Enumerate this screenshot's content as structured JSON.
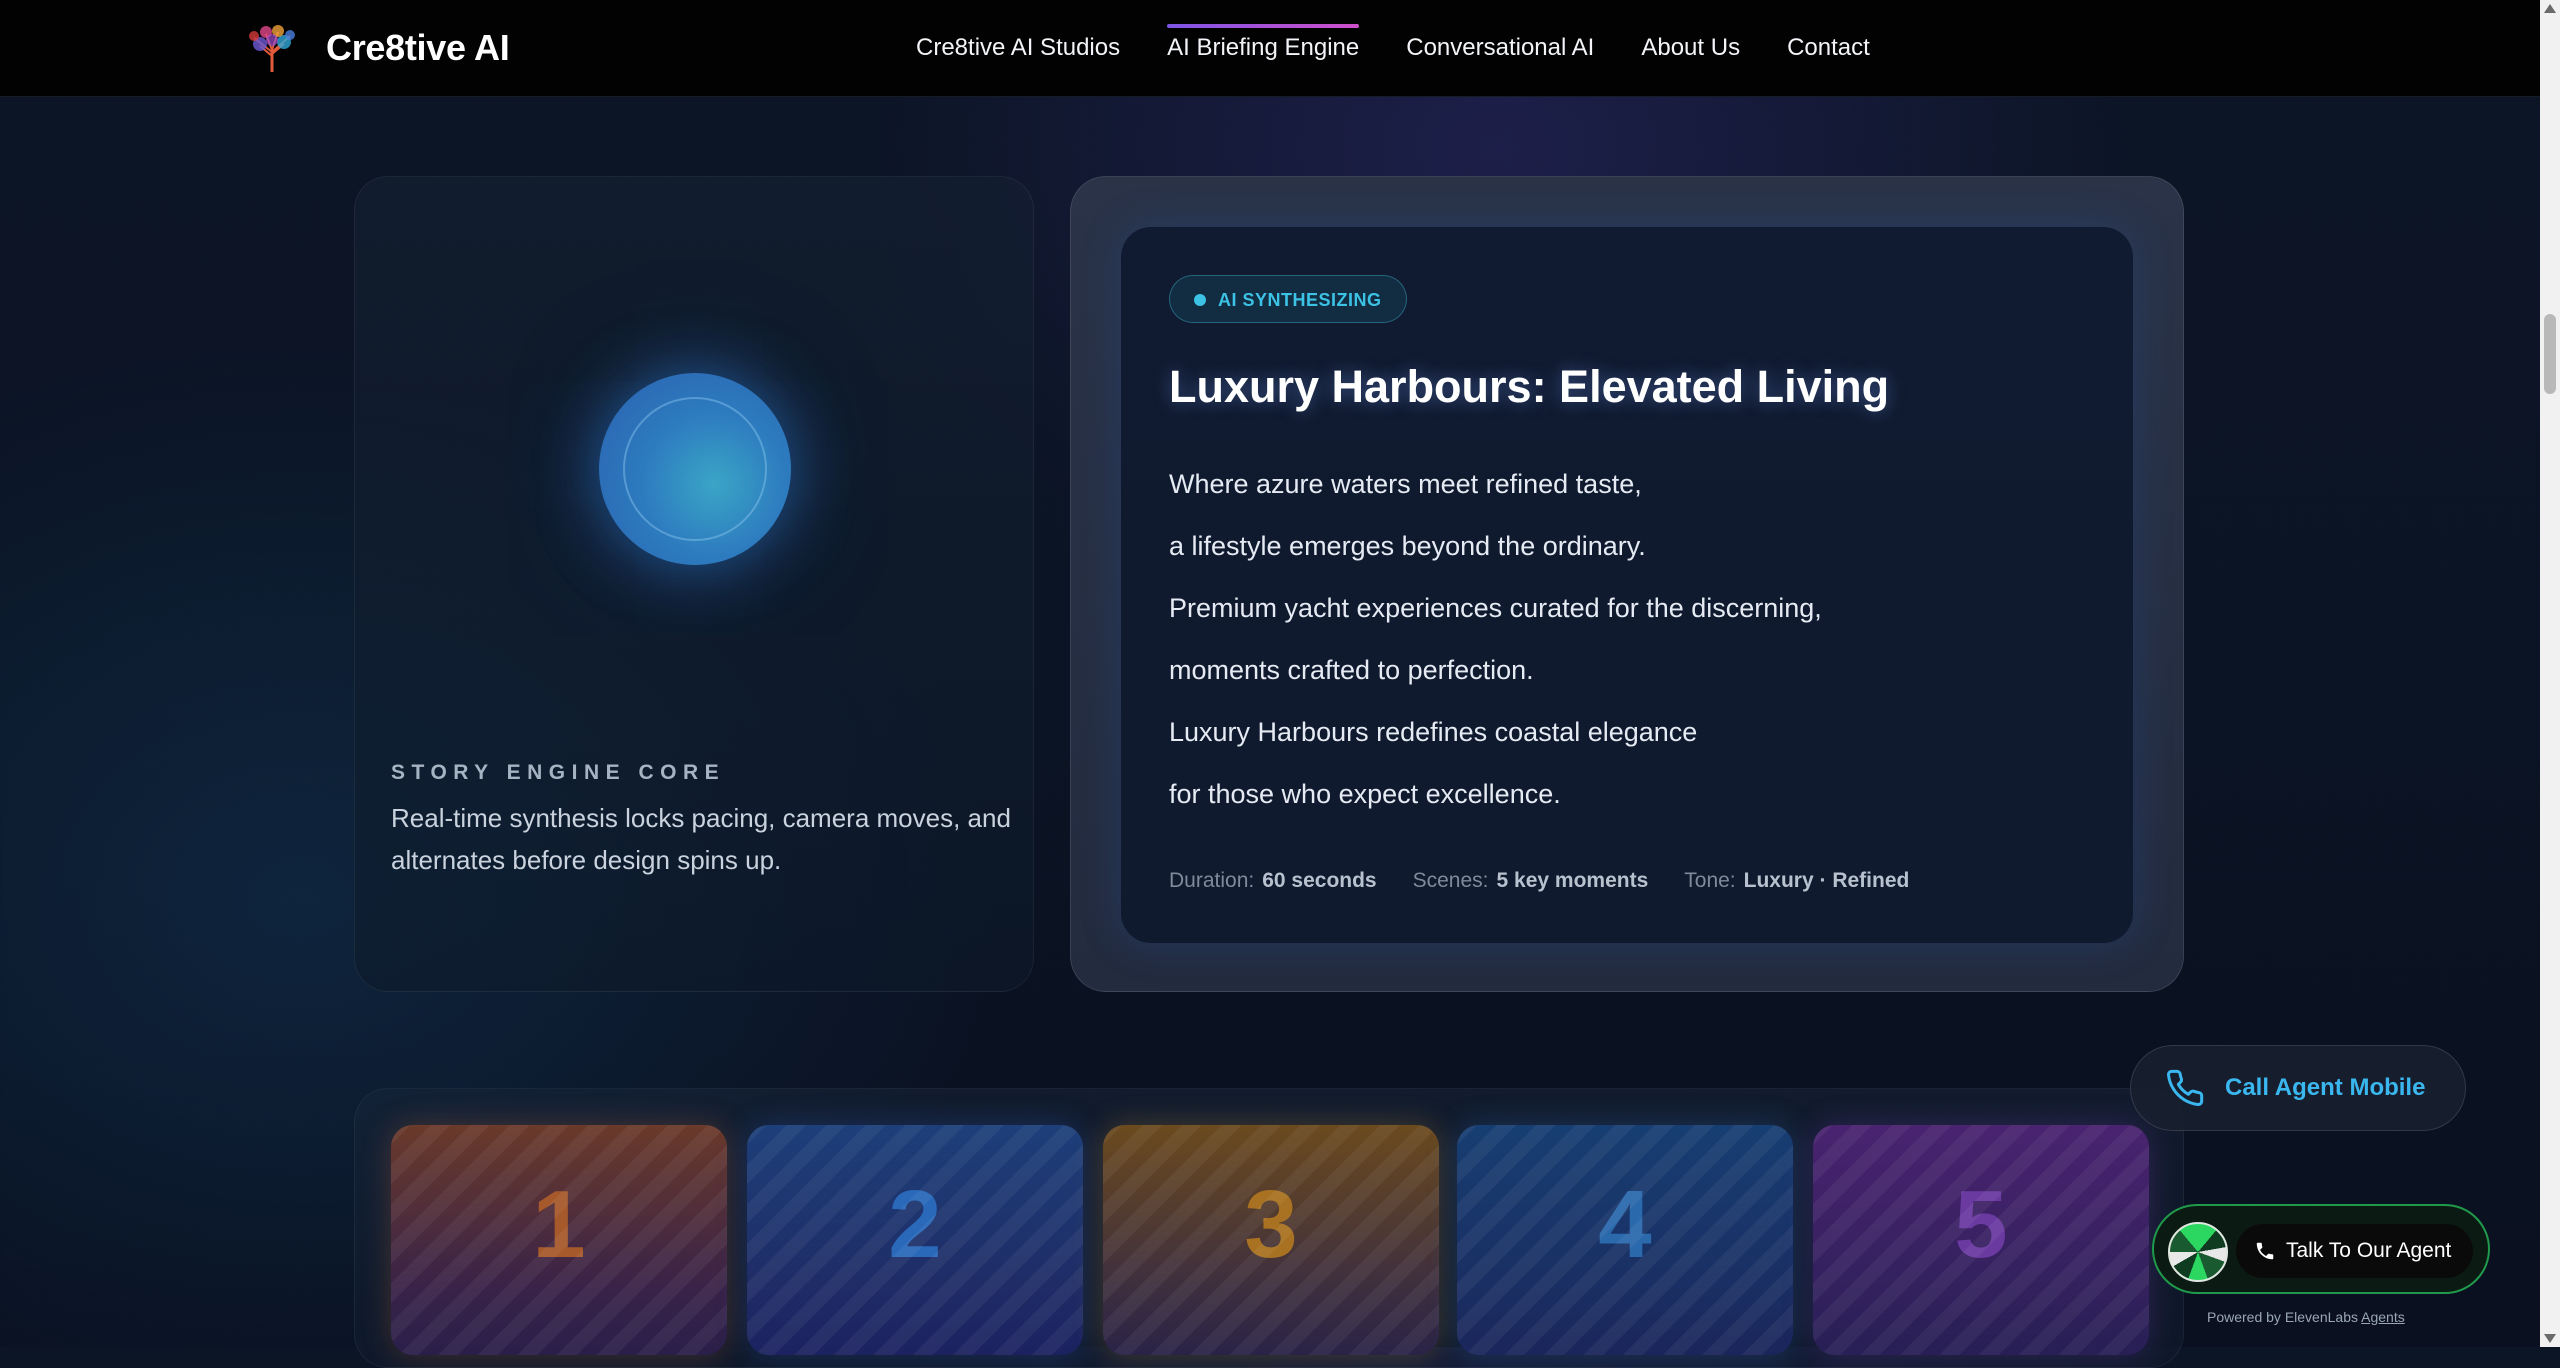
{
  "header": {
    "brand_name": "Cre8tive AI",
    "nav": [
      {
        "label": "Cre8tive AI Studios"
      },
      {
        "label": "AI Briefing Engine",
        "active": true
      },
      {
        "label": "Conversational AI"
      },
      {
        "label": "About Us"
      },
      {
        "label": "Contact"
      }
    ]
  },
  "core": {
    "label": "STORY ENGINE CORE",
    "description": "Real-time synthesis locks pacing, camera moves, and alternates before design spins up."
  },
  "brief": {
    "status": "AI SYNTHESIZING",
    "title": "Luxury Harbours: Elevated Living",
    "lines": [
      "Where azure waters meet refined taste,",
      "a lifestyle emerges beyond the ordinary.",
      "Premium yacht experiences curated for the discerning,",
      "moments crafted to perfection.",
      "Luxury Harbours redefines coastal elegance",
      "for those who expect excellence."
    ],
    "meta": [
      {
        "label": "Duration:",
        "value": "60 seconds"
      },
      {
        "label": "Scenes:",
        "value": "5 key moments"
      },
      {
        "label": "Tone:",
        "value": "Luxury · Refined"
      }
    ]
  },
  "scenes": [
    "1",
    "2",
    "3",
    "4",
    "5"
  ],
  "widgets": {
    "call_mobile_label": "Call Agent Mobile",
    "talk_label": "Talk To Our Agent",
    "powered_by": "Powered by ElevenLabs",
    "powered_link": "Agents"
  },
  "colors": {
    "accent_cyan": "#3cc2e4",
    "call_blue": "#3ab7ee",
    "nav_active_gradient": [
      "#7d55e6",
      "#d04fc9"
    ],
    "widget_green": "#1f9a4a"
  }
}
